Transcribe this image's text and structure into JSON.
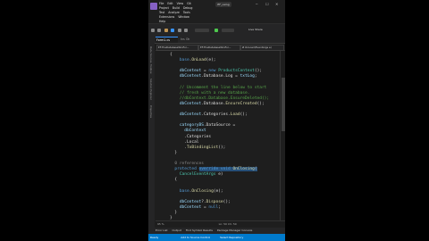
{
  "title_bar": {
    "project_name": "EF_using",
    "menu_rows": [
      [
        "File",
        "Edit",
        "View",
        "Git"
      ],
      [
        "Project",
        "Build",
        "Debug"
      ],
      [
        "Test",
        "Analyze",
        "Tools"
      ],
      [
        "Extensions",
        "Window"
      ],
      [
        "Help"
      ]
    ],
    "live_share": "Live Share"
  },
  "tabs": {
    "active": "Form1.cs",
    "second": "Ins Ok"
  },
  "nav_dropdowns": [
    "EF.TheDatabaseWinFor...",
    "EF.TheDatabaseWinFor...",
    "Ø OnLoad(EventArgs e)"
  ],
  "side_labels": [
    "Data Sources",
    "Toolbox",
    "Solution Explorer",
    "Properties"
  ],
  "code_lines": [
    {
      "n": "",
      "segs": [
        [
          "",
          "{"
        ]
      ]
    },
    {
      "n": "",
      "segs": [
        [
          "k",
          "    base"
        ],
        [
          "",
          "."
        ],
        [
          "m",
          "OnLoad"
        ],
        [
          "",
          "(e);"
        ]
      ]
    },
    {
      "n": "",
      "segs": [
        [
          "",
          ""
        ]
      ]
    },
    {
      "n": "",
      "segs": [
        [
          "p",
          "    dbContext"
        ],
        [
          "",
          " = "
        ],
        [
          "k",
          "new "
        ],
        [
          "t",
          "ProductsContext"
        ],
        [
          "",
          "();"
        ]
      ]
    },
    {
      "n": "",
      "segs": [
        [
          "p",
          "    dbContext"
        ],
        [
          "",
          ".Database"
        ],
        [
          "",
          ".Log = "
        ],
        [
          "p",
          "txtLog"
        ],
        [
          "",
          ";"
        ]
      ]
    },
    {
      "n": "",
      "segs": [
        [
          "",
          ""
        ]
      ]
    },
    {
      "n": "",
      "segs": [
        [
          "c",
          "    // Uncomment the line below to start"
        ]
      ]
    },
    {
      "n": "",
      "segs": [
        [
          "c",
          "    // fresh with a new database."
        ]
      ]
    },
    {
      "n": "",
      "segs": [
        [
          "c",
          "    //dbContext.Database.EnsureDeleted();"
        ]
      ]
    },
    {
      "n": "",
      "segs": [
        [
          "p",
          "    dbContext"
        ],
        [
          "",
          ".Database."
        ],
        [
          "m",
          "EnsureCreated"
        ],
        [
          "",
          "();"
        ]
      ]
    },
    {
      "n": "",
      "segs": [
        [
          "",
          ""
        ]
      ]
    },
    {
      "n": "",
      "segs": [
        [
          "p",
          "    dbContext"
        ],
        [
          "",
          ".Categories."
        ],
        [
          "m",
          "Load"
        ],
        [
          "",
          "();"
        ]
      ]
    },
    {
      "n": "",
      "segs": [
        [
          "",
          ""
        ]
      ]
    },
    {
      "n": "",
      "segs": [
        [
          "p",
          "    categoryBS"
        ],
        [
          "",
          ".DataSource ="
        ]
      ]
    },
    {
      "n": "",
      "segs": [
        [
          "p",
          "      dbContext"
        ]
      ]
    },
    {
      "n": "",
      "segs": [
        [
          "",
          "      .Categories"
        ]
      ]
    },
    {
      "n": "",
      "segs": [
        [
          "",
          "      .Local"
        ]
      ]
    },
    {
      "n": "",
      "segs": [
        [
          "",
          "      ."
        ],
        [
          "m",
          "ToBindingList"
        ],
        [
          "",
          "();"
        ]
      ]
    },
    {
      "n": "",
      "segs": [
        [
          "",
          "  }"
        ]
      ]
    },
    {
      "n": "",
      "segs": [
        [
          "",
          ""
        ]
      ]
    },
    {
      "n": "",
      "segs": [
        [
          "g",
          "  0 references"
        ]
      ]
    },
    {
      "n": "",
      "segs": [
        [
          "k",
          "  protected "
        ],
        [
          "k",
          "override "
        ],
        [
          "k",
          "void "
        ],
        [
          "m",
          "OnClosing"
        ],
        [
          "",
          "("
        ]
      ]
    },
    {
      "n": "",
      "segs": [
        [
          "t",
          "    CancelEventArgs"
        ],
        [
          "",
          " e)"
        ]
      ]
    },
    {
      "n": "",
      "segs": [
        [
          "",
          "  {"
        ]
      ]
    },
    {
      "n": "",
      "segs": [
        [
          "",
          ""
        ]
      ]
    },
    {
      "n": "",
      "segs": [
        [
          "k",
          "    base"
        ],
        [
          "",
          "."
        ],
        [
          "m",
          "OnClosing"
        ],
        [
          "",
          "(e);"
        ]
      ]
    },
    {
      "n": "",
      "segs": [
        [
          "",
          ""
        ]
      ]
    },
    {
      "n": "",
      "segs": [
        [
          "p",
          "    dbContext"
        ],
        [
          "",
          "?."
        ],
        [
          "m",
          "Dispose"
        ],
        [
          "",
          "();"
        ]
      ]
    },
    {
      "n": "",
      "segs": [
        [
          "p",
          "    dbContext"
        ],
        [
          "",
          " = "
        ],
        [
          "k",
          "null"
        ],
        [
          "",
          ";"
        ]
      ]
    },
    {
      "n": "",
      "segs": [
        [
          "",
          "  }"
        ]
      ]
    },
    {
      "n": "",
      "segs": [
        [
          "",
          "}"
        ]
      ]
    }
  ],
  "editor_status": {
    "zoom": "95 %",
    "position": "Ln: 50  Ch: 50"
  },
  "bottom_tabs": [
    "Error List",
    "Output",
    "Find Symbol Results",
    "Package Manager Console"
  ],
  "status_bar": {
    "left": "Ready",
    "source_control": "Add to Source Control",
    "repository": "Select Repository"
  }
}
